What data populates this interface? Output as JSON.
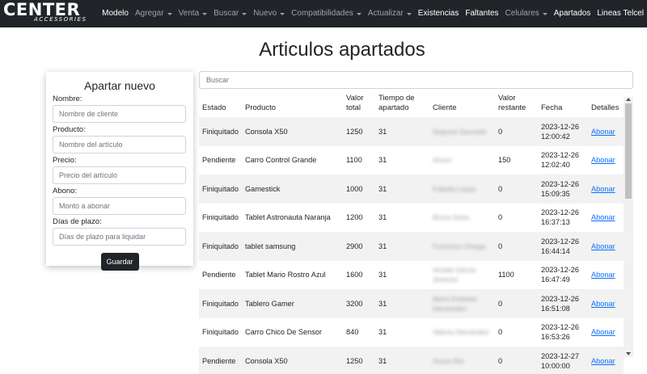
{
  "brand": {
    "name": "CENTER",
    "subtitle": "ACCESSORIES"
  },
  "nav": {
    "items": [
      {
        "label": "Modelo",
        "dropdown": false,
        "active": true
      },
      {
        "label": "Agregar",
        "dropdown": true,
        "active": false
      },
      {
        "label": "Venta",
        "dropdown": true,
        "active": false
      },
      {
        "label": "Buscar",
        "dropdown": true,
        "active": false
      },
      {
        "label": "Nuevo",
        "dropdown": true,
        "active": false
      },
      {
        "label": "Compatibilidades",
        "dropdown": true,
        "active": false
      },
      {
        "label": "Actualizar",
        "dropdown": true,
        "active": false
      },
      {
        "label": "Existencias",
        "dropdown": false,
        "active": true
      },
      {
        "label": "Faltantes",
        "dropdown": false,
        "active": true
      },
      {
        "label": "Celulares",
        "dropdown": true,
        "active": false
      },
      {
        "label": "Apartados",
        "dropdown": false,
        "active": true
      },
      {
        "label": "Lineas Telcel",
        "dropdown": false,
        "active": true
      }
    ]
  },
  "page": {
    "title": "Articulos apartados"
  },
  "form": {
    "title": "Apartar nuevo",
    "fields": {
      "nombre": {
        "label": "Nombre:",
        "placeholder": "Nombre de cliente"
      },
      "producto": {
        "label": "Producto:",
        "placeholder": "Nombre del artículo"
      },
      "precio": {
        "label": "Precio:",
        "placeholder": "Precio del artículo"
      },
      "abono": {
        "label": "Abono:",
        "placeholder": "Monto a abonar"
      },
      "dias": {
        "label": "Días de plazo:",
        "placeholder": "Días de plazo para liquidar"
      }
    },
    "submit_label": "Guardar"
  },
  "search": {
    "placeholder": "Buscar"
  },
  "table": {
    "headers": [
      "Estado",
      "Producto",
      "Valor total",
      "Tiempo de apartado",
      "Cliente",
      "Valor restante",
      "Fecha",
      "Detalles"
    ],
    "rows": [
      {
        "estado": "Finiquitado",
        "producto": "Consola X50",
        "valor_total": "1250",
        "tiempo": "31",
        "cliente": "Segovia Saucedo",
        "restante": "0",
        "fecha": "2023-12-26 12:00:42",
        "detalles": "Abonar"
      },
      {
        "estado": "Pendiente",
        "producto": "Carro Control Grande",
        "valor_total": "1100",
        "tiempo": "31",
        "cliente": "Arturo",
        "restante": "150",
        "fecha": "2023-12-26 12:02:40",
        "detalles": "Abonar"
      },
      {
        "estado": "Finiquitado",
        "producto": "Gamestick",
        "valor_total": "1000",
        "tiempo": "31",
        "cliente": "Fabiola Lopez",
        "restante": "0",
        "fecha": "2023-12-26 15:09:35",
        "detalles": "Abonar"
      },
      {
        "estado": "Finiquitado",
        "producto": "Tablet Astronauta Naranja",
        "valor_total": "1200",
        "tiempo": "31",
        "cliente": "Bruno Soria",
        "restante": "0",
        "fecha": "2023-12-26 16:37:13",
        "detalles": "Abonar"
      },
      {
        "estado": "Finiquitado",
        "producto": "tablet samsung",
        "valor_total": "2900",
        "tiempo": "31",
        "cliente": "Francisco Ortega",
        "restante": "0",
        "fecha": "2023-12-26 16:44:14",
        "detalles": "Abonar"
      },
      {
        "estado": "Pendiente",
        "producto": "Tablet Mario Rostro Azul",
        "valor_total": "1600",
        "tiempo": "31",
        "cliente": "Amalia Garcia Jimenez",
        "restante": "1100",
        "fecha": "2023-12-26 16:47:49",
        "detalles": "Abonar"
      },
      {
        "estado": "Finiquitado",
        "producto": "Tablero Gamer",
        "valor_total": "3200",
        "tiempo": "31",
        "cliente": "Mario Esteban Hernandez",
        "restante": "0",
        "fecha": "2023-12-26 16:51:08",
        "detalles": "Abonar"
      },
      {
        "estado": "Finiquitado",
        "producto": "Carro Chico De Sensor",
        "valor_total": "840",
        "tiempo": "31",
        "cliente": "Valeria Hernandez",
        "restante": "0",
        "fecha": "2023-12-26 16:53:26",
        "detalles": "Abonar"
      },
      {
        "estado": "Pendiente",
        "producto": "Consola X50",
        "valor_total": "1250",
        "tiempo": "31",
        "cliente": "Arturo Rei",
        "restante": "0",
        "fecha": "2023-12-27 10:00:00",
        "detalles": "Abonar"
      }
    ]
  },
  "colors": {
    "navbar": "#212529",
    "link": "#0d6efd",
    "row_stripe": "#f2f2f2",
    "button": "#212529"
  }
}
